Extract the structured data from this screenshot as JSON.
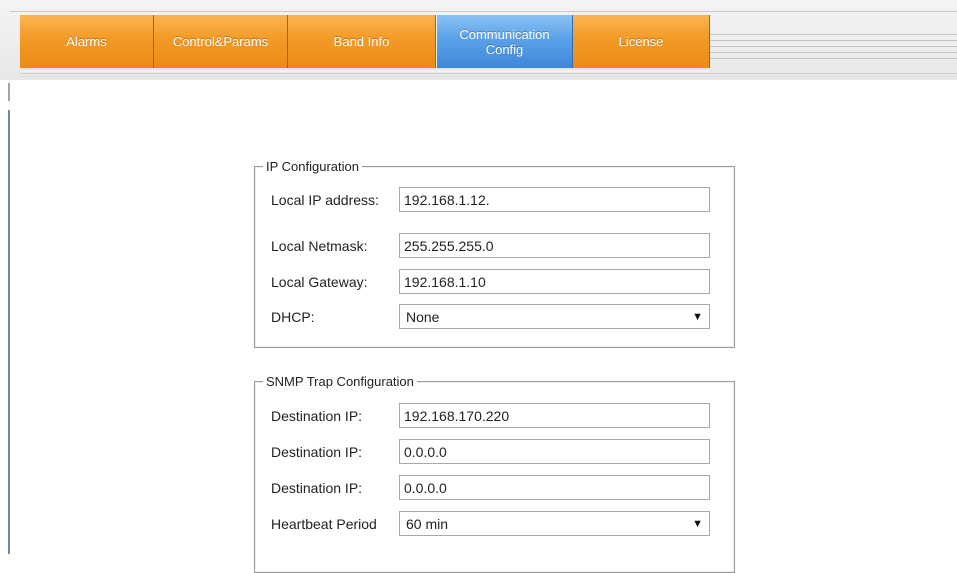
{
  "tabs": [
    {
      "label": "Alarms",
      "active": false
    },
    {
      "label": "Control&Params",
      "active": false
    },
    {
      "label": "Band Info",
      "active": false
    },
    {
      "label": "Communication\nConfig",
      "active": true
    },
    {
      "label": "License",
      "active": false
    }
  ],
  "ip_config": {
    "title": "IP Configuration",
    "local_ip_label": "Local IP address:",
    "local_ip_value": "192.168.1.12.",
    "netmask_label": "Local Netmask:",
    "netmask_value": "255.255.255.0",
    "gateway_label": "Local Gateway:",
    "gateway_value": "192.168.1.10",
    "dhcp_label": "DHCP:",
    "dhcp_value": "None"
  },
  "snmp_config": {
    "title": "SNMP Trap Configuration",
    "dest1_label": "Destination IP:",
    "dest1_value": "192.168.170.220",
    "dest2_label": "Destination IP:",
    "dest2_value": "0.0.0.0",
    "dest3_label": "Destination IP:",
    "dest3_value": "0.0.0.0",
    "heartbeat_label": "Heartbeat Period",
    "heartbeat_value": "60 min"
  },
  "icons": {
    "dropdown": "triangle-down-icon"
  }
}
